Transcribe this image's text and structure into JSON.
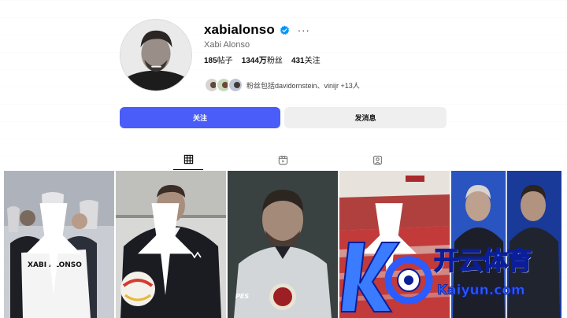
{
  "profile": {
    "username": "xabialonso",
    "full_name": "Xabi Alonso",
    "more_label": "···",
    "stats": {
      "posts_value": "185",
      "posts_label": "帖子",
      "followers_value": "1344万",
      "followers_label": "粉丝",
      "following_value": "431",
      "following_label": "关注"
    },
    "followed_by_text": "粉丝包括davidornstein、vinijr +13人"
  },
  "buttons": {
    "follow_label": "关注",
    "message_label": "发消息"
  },
  "tabs": [
    {
      "icon": "grid-icon",
      "active": true
    },
    {
      "icon": "reels-icon",
      "active": false
    },
    {
      "icon": "tagged-icon",
      "active": false
    }
  ],
  "posts": [
    {
      "caption": "XABI ALONSO",
      "pinned": true
    },
    {
      "caption": "",
      "pinned": true
    },
    {
      "caption": "PES",
      "pinned": false
    },
    {
      "caption": "",
      "pinned": true
    },
    {
      "caption": "",
      "pinned": false
    }
  ],
  "watermark": {
    "text": "开云体育",
    "url": "Kaiyun.com"
  },
  "colors": {
    "accent": "#4a5df9",
    "verified": "#0095f6",
    "secondary_button": "#efefef"
  }
}
